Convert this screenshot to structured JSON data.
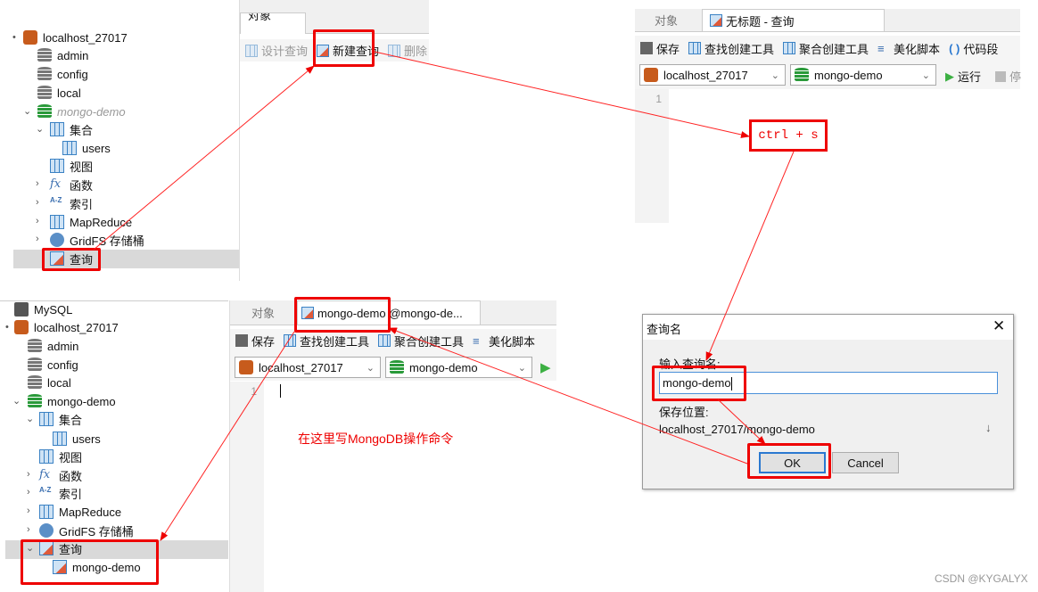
{
  "panel_top_left": {
    "tree": [
      {
        "label": "localhost_27017",
        "icon": "mongodb-connection-icon"
      },
      {
        "label": "admin",
        "icon": "database-icon"
      },
      {
        "label": "config",
        "icon": "database-icon"
      },
      {
        "label": "local",
        "icon": "database-icon"
      },
      {
        "label": "mongo-demo",
        "icon": "database-icon-green"
      },
      {
        "label": "集合",
        "icon": "collection-icon"
      },
      {
        "label": "users",
        "icon": "table-icon"
      },
      {
        "label": "视图",
        "icon": "view-icon"
      },
      {
        "label": "函数",
        "icon": "function-icon"
      },
      {
        "label": "索引",
        "icon": "index-icon"
      },
      {
        "label": "MapReduce",
        "icon": "mapreduce-icon"
      },
      {
        "label": "GridFS 存储桶",
        "icon": "gridfs-icon"
      },
      {
        "label": "查询",
        "icon": "query-icon"
      }
    ],
    "tab_objects": "对象",
    "toolbar": {
      "design_query": "设计查询",
      "new_query": "新建查询",
      "delete": "删除"
    }
  },
  "panel_top_right": {
    "tabs": [
      "对象",
      "无标题 - 查询"
    ],
    "toolbar": {
      "save": "保存",
      "find_builder": "查找创建工具",
      "aggregate_builder": "聚合创建工具",
      "beautify": "美化脚本",
      "snippet": "代码段"
    },
    "connection": "localhost_27017",
    "database": "mongo-demo",
    "run": "运行",
    "stop": "停",
    "line_number": "1",
    "annotation": "ctrl + s"
  },
  "panel_bottom_left": {
    "tree": [
      {
        "label": "MySQL",
        "icon": "mysql-icon"
      },
      {
        "label": "localhost_27017",
        "icon": "mongodb-connection-icon"
      },
      {
        "label": "admin",
        "icon": "database-icon"
      },
      {
        "label": "config",
        "icon": "database-icon"
      },
      {
        "label": "local",
        "icon": "database-icon"
      },
      {
        "label": "mongo-demo",
        "icon": "database-icon-green"
      },
      {
        "label": "集合",
        "icon": "collection-icon"
      },
      {
        "label": "users",
        "icon": "table-icon"
      },
      {
        "label": "视图",
        "icon": "view-icon"
      },
      {
        "label": "函数",
        "icon": "function-icon"
      },
      {
        "label": "索引",
        "icon": "index-icon"
      },
      {
        "label": "MapReduce",
        "icon": "mapreduce-icon"
      },
      {
        "label": "GridFS 存储桶",
        "icon": "gridfs-icon"
      },
      {
        "label": "查询",
        "icon": "query-icon"
      },
      {
        "label": "mongo-demo",
        "icon": "query-icon"
      }
    ],
    "tabs": [
      "对象",
      "mongo-demo @mongo-de..."
    ],
    "toolbar": {
      "save": "保存",
      "find_builder": "查找创建工具",
      "aggregate_builder": "聚合创建工具",
      "beautify": "美化脚本"
    },
    "connection": "localhost_27017",
    "database": "mongo-demo",
    "line_number": "1",
    "annotation": "在这里写MongoDB操作命令"
  },
  "dialog": {
    "title": "查询名",
    "name_label": "输入查询名:",
    "name_value": "mongo-demo",
    "location_label": "保存位置:",
    "location_value": "localhost_27017/mongo-demo",
    "ok": "OK",
    "cancel": "Cancel"
  },
  "watermark": "CSDN @KYGALYX",
  "colors": {
    "annotation_red": "#ee0000",
    "selection": "#d9d9d9",
    "run_green": "#3cb043"
  }
}
